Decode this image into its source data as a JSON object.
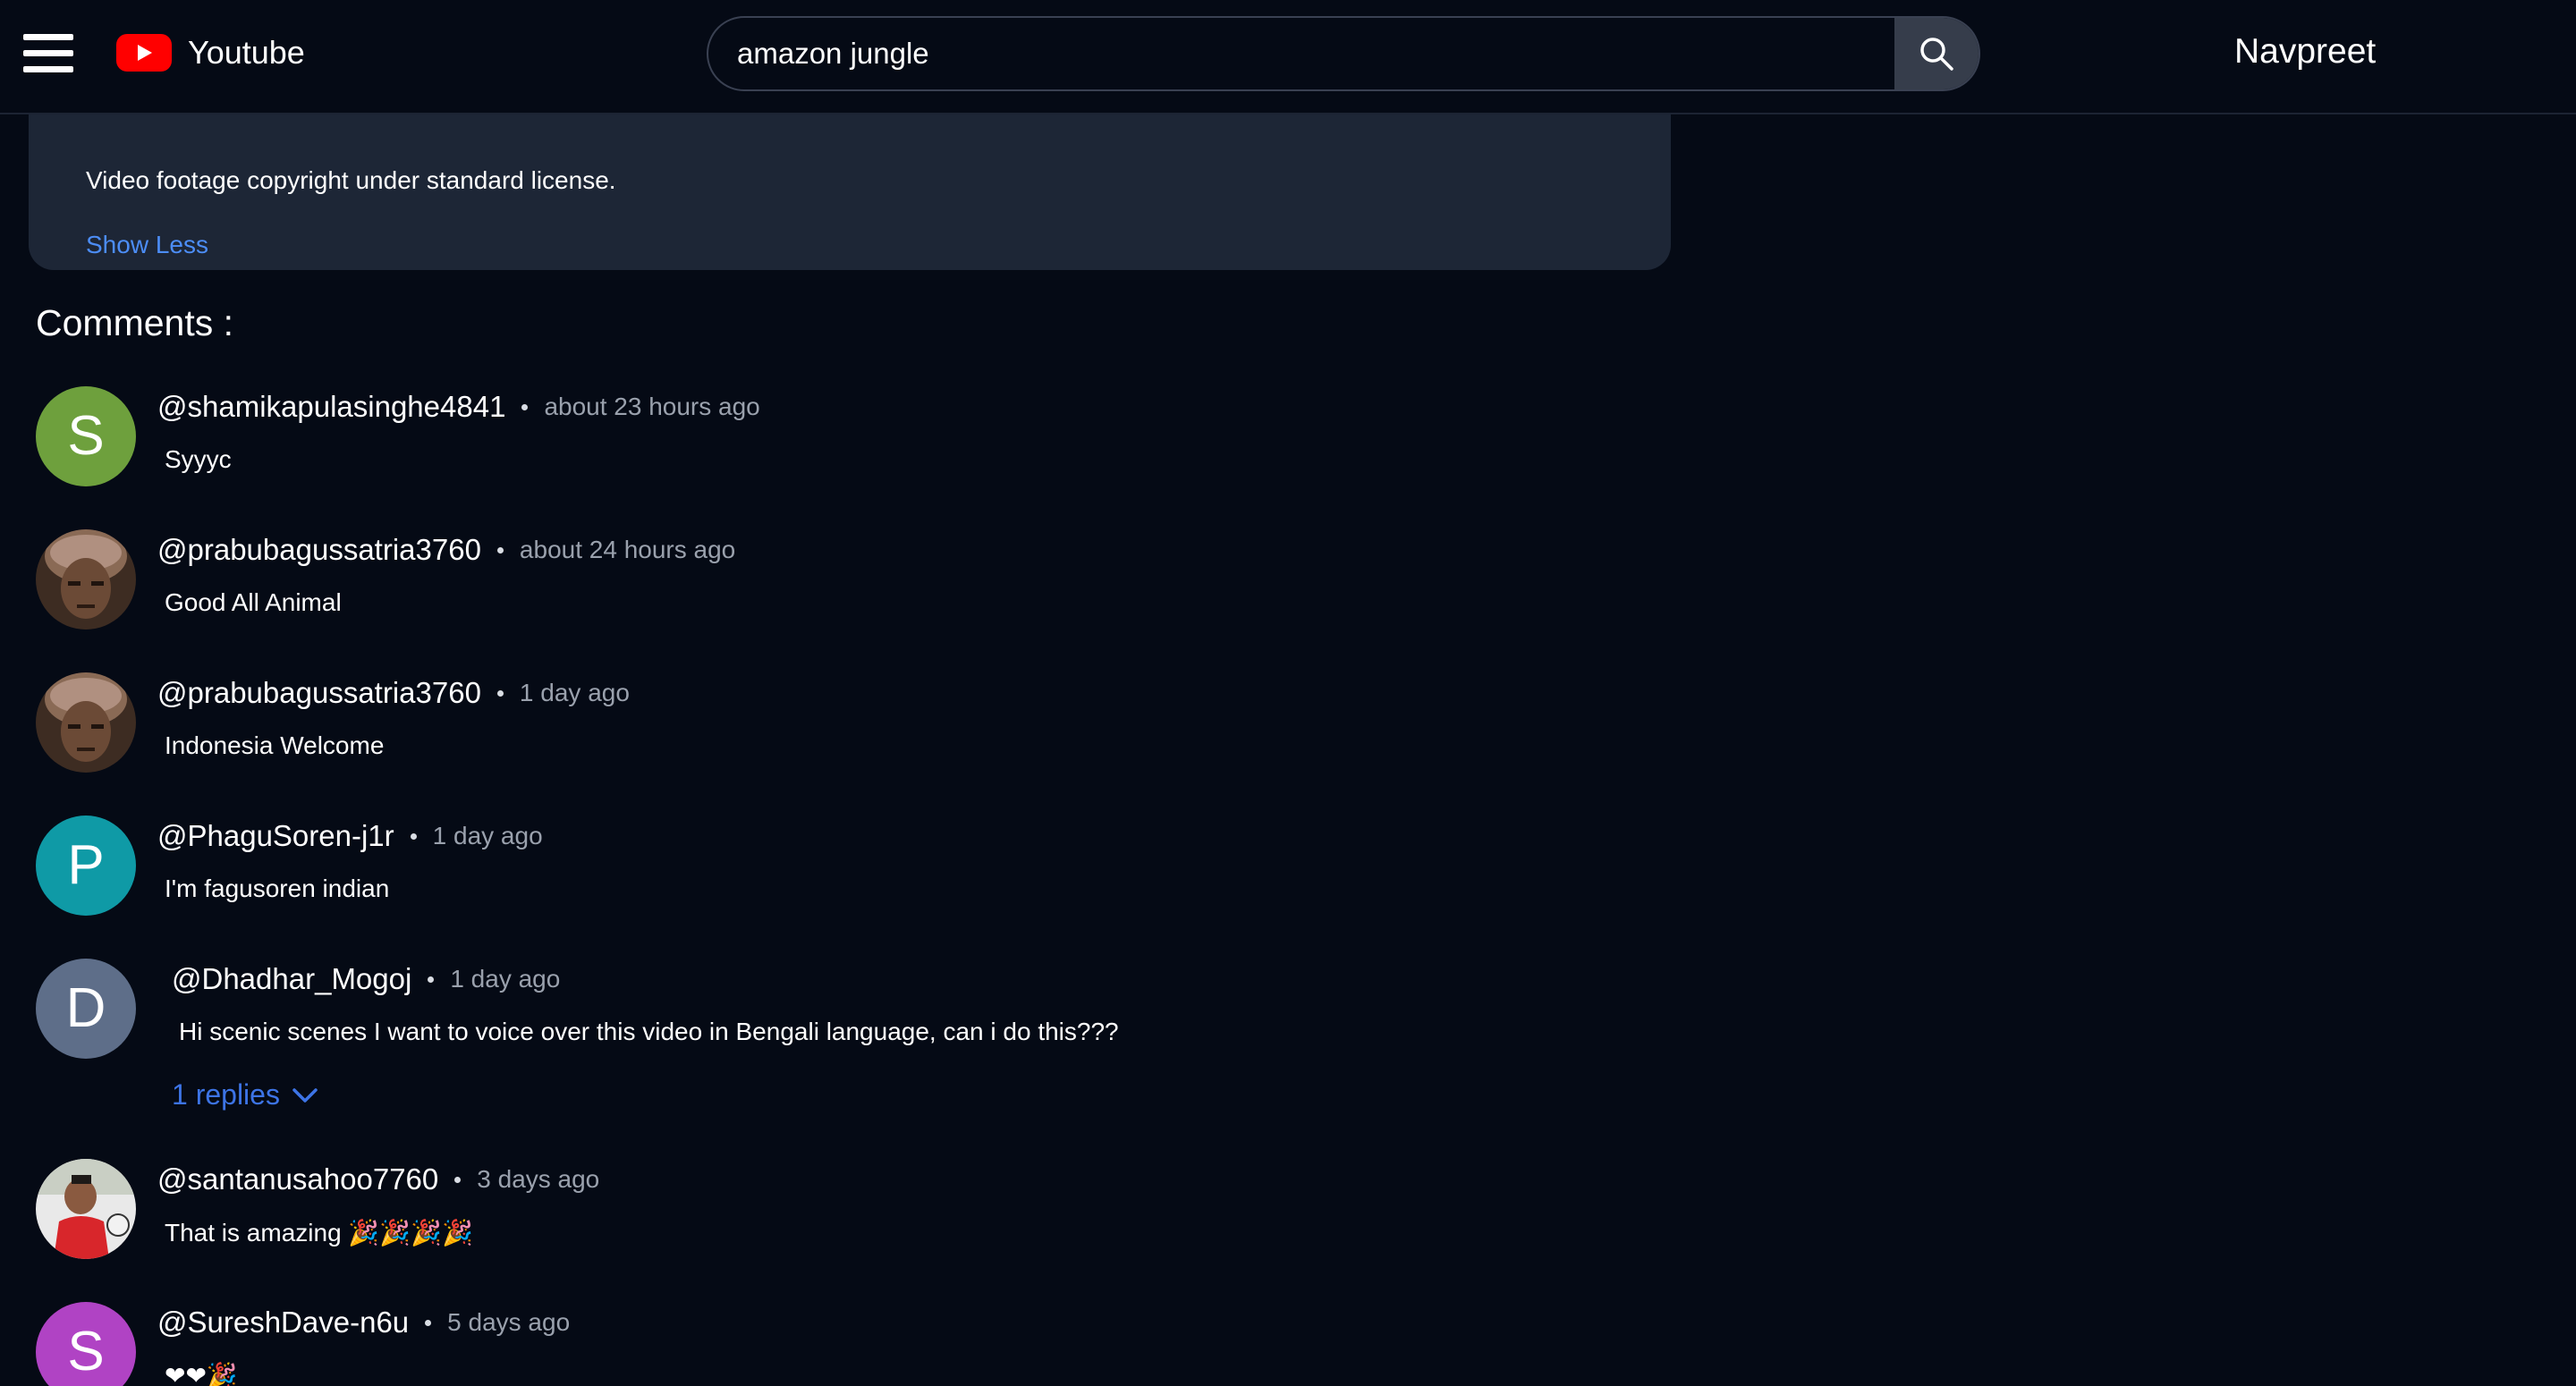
{
  "header": {
    "logo_text": "Youtube",
    "search_value": "amazon jungle",
    "user_name": "Navpreet"
  },
  "description": {
    "text": "Video footage copyright under standard license.",
    "toggle_label": "Show Less"
  },
  "comments_title": "Comments :",
  "comments": [
    {
      "user": "@shamikapulasinghe4841",
      "time": "about 23 hours ago",
      "text": "Syyyc",
      "avatar_letter": "S",
      "avatar_color": "#6ea03d"
    },
    {
      "user": "@prabubagussatria3760",
      "time": "about 24 hours ago",
      "text": "Good All Animal",
      "avatar_letter": "",
      "avatar_color": "#5a4335"
    },
    {
      "user": "@prabubagussatria3760",
      "time": "1 day ago",
      "text": "Indonesia Welcome",
      "avatar_letter": "",
      "avatar_color": "#5a4335"
    },
    {
      "user": "@PhaguSoren-j1r",
      "time": "1 day ago",
      "text": "I'm fagusoren indian",
      "avatar_letter": "P",
      "avatar_color": "#0f9aa6"
    },
    {
      "user": "@Dhadhar_Mogoj",
      "time": "1 day ago",
      "text": "Hi scenic scenes I want to voice over this video in Bengali language, can i do this???",
      "avatar_letter": "D",
      "avatar_color": "#5e6e89",
      "replies_label": "1 replies"
    },
    {
      "user": "@santanusahoo7760",
      "time": "3 days ago",
      "text": "That is amazing 🎉🎉🎉🎉",
      "avatar_letter": "",
      "avatar_color": "#e4e4e4"
    },
    {
      "user": "@SureshDave-n6u",
      "time": "5 days ago",
      "text": "❤❤🎉",
      "avatar_letter": "S",
      "avatar_color": "#b043c4"
    }
  ],
  "colors": {
    "background": "#050a15",
    "card": "#1d2636",
    "link": "#4c8df6",
    "replies": "#3d74e6",
    "brand_red": "#ff0000"
  },
  "icons": {
    "menu": "hamburger-icon",
    "logo": "youtube-play-icon",
    "search": "search-icon",
    "replies_toggle": "chevron-down-icon"
  }
}
